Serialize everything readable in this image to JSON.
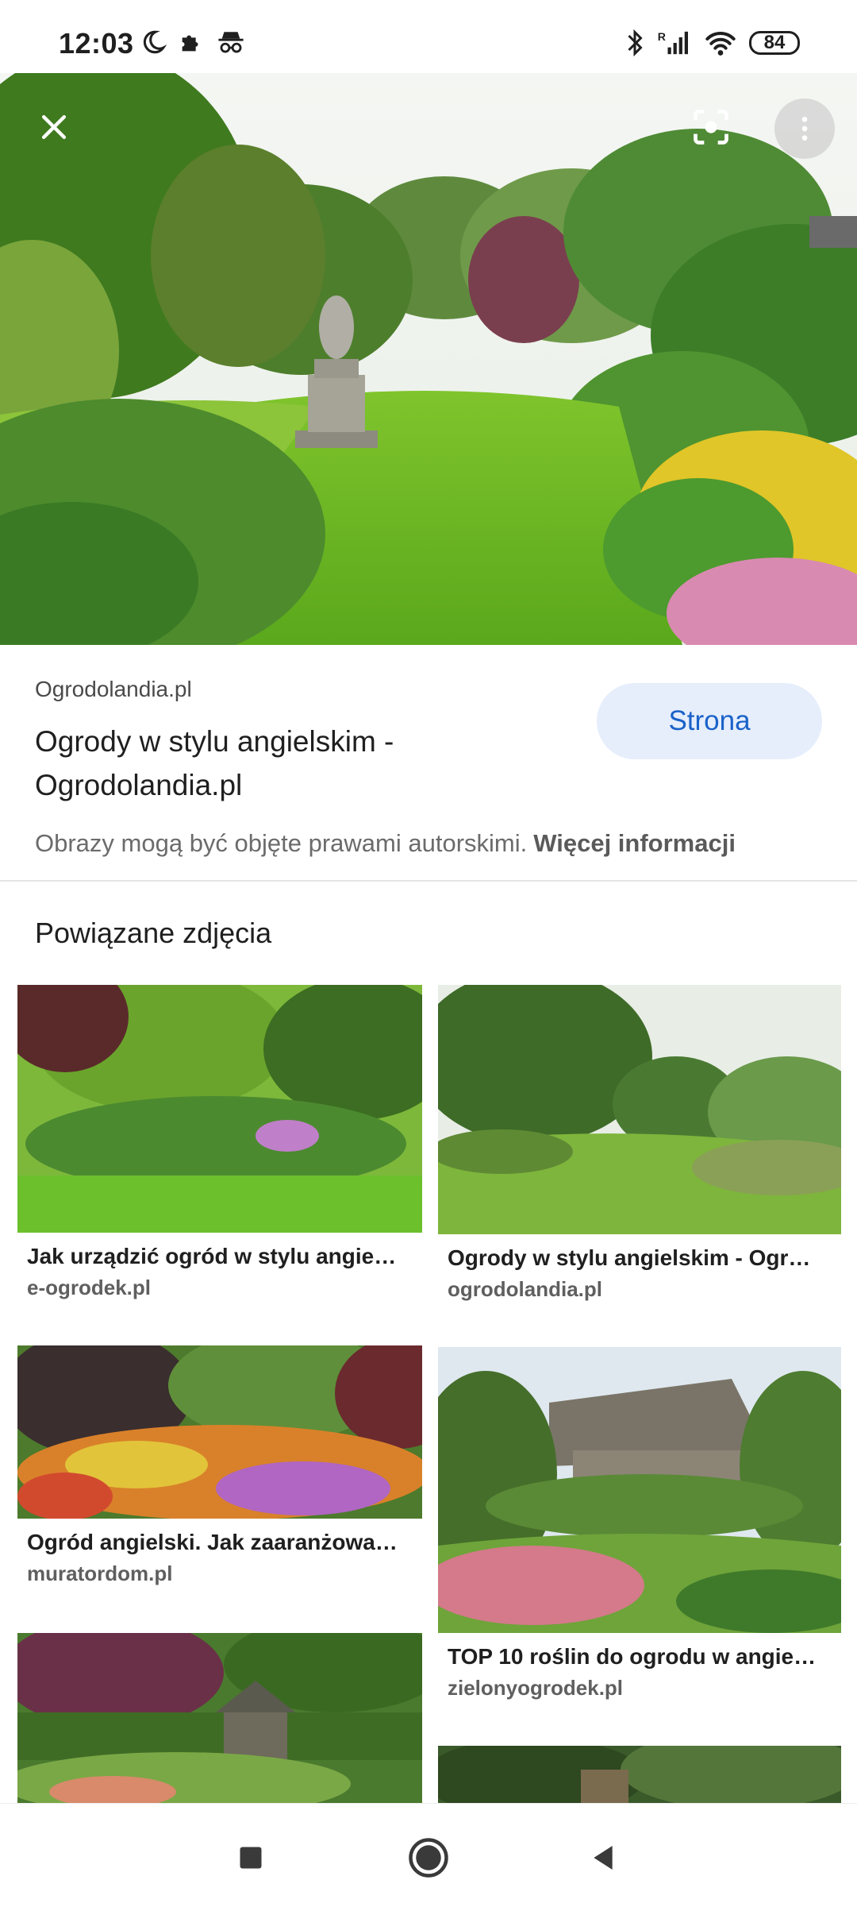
{
  "status": {
    "time": "12:03",
    "battery": "84"
  },
  "hero": {
    "close_icon": "close-icon",
    "lens_icon": "lens-icon",
    "menu_icon": "more-vert-icon"
  },
  "info": {
    "source": "Ogrodolandia.pl",
    "title": "Ogrody w stylu angielskim - Ogrodolandia.pl",
    "visit_button": "Strona",
    "copyright": "Obrazy mogą być objęte prawami autorskimi.",
    "more_info": "Więcej informacji"
  },
  "related": {
    "heading": "Powiązane zdjęcia",
    "items": [
      {
        "title": "Jak urządzić ogród w stylu angie…",
        "source": "e-ogrodek.pl"
      },
      {
        "title": "Ogrody w stylu angielskim - Ogr…",
        "source": "ogrodolandia.pl"
      },
      {
        "title": "Ogród angielski. Jak zaaranżowa…",
        "source": "muratordom.pl"
      },
      {
        "title": "TOP 10 roślin do ogrodu w angie…",
        "source": "zielonyogrodek.pl"
      }
    ]
  },
  "colors": {
    "accent": "#1a62c8",
    "button_bg": "#e6eefc"
  }
}
